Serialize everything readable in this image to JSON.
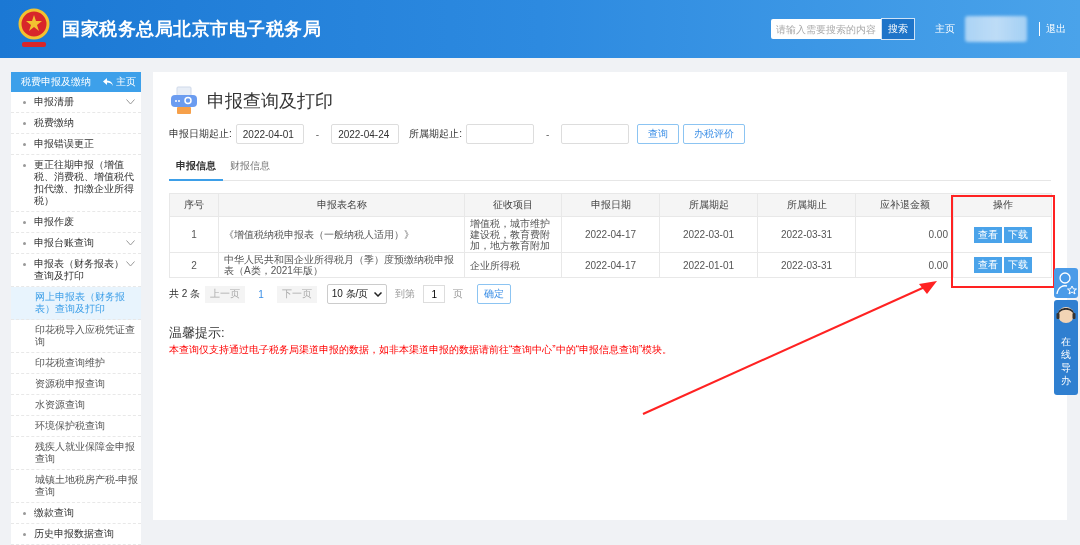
{
  "header": {
    "title": "国家税务总局北京市电子税务局",
    "search": {
      "placeholder": "请输入需要搜索的内容",
      "button": "搜索"
    },
    "home_link": "主页",
    "logout_link": "退出"
  },
  "sidebar": {
    "title": "税费申报及缴纳",
    "home_link": "主页",
    "items": [
      {
        "label": "申报清册",
        "expandable": true,
        "selected": false
      },
      {
        "label": "税费缴纳",
        "expandable": false,
        "selected": false
      },
      {
        "label": "申报错误更正",
        "expandable": false,
        "selected": false
      },
      {
        "label": "更正往期申报（增值税、消费税、增值税代扣代缴、扣缴企业所得税）",
        "expandable": false,
        "selected": false
      },
      {
        "label": "申报作废",
        "expandable": false,
        "selected": false
      },
      {
        "label": "申报台账查询",
        "expandable": true,
        "selected": false
      },
      {
        "label": "申报表（财务报表）查询及打印",
        "expandable": true,
        "selected": false,
        "children": [
          {
            "label": "网上申报表（财务报表）查询及打印",
            "selected": true
          },
          {
            "label": "印花税导入应税凭证查询",
            "selected": false
          },
          {
            "label": "印花税查询维护",
            "selected": false
          },
          {
            "label": "资源税申报查询",
            "selected": false
          },
          {
            "label": "水资源查询",
            "selected": false
          },
          {
            "label": "环境保护税查询",
            "selected": false
          },
          {
            "label": "残疾人就业保障金申报查询",
            "selected": false
          },
          {
            "label": "城镇土地税房产税-申报查询",
            "selected": false
          }
        ]
      },
      {
        "label": "缴款查询",
        "expandable": false,
        "selected": false
      },
      {
        "label": "历史申报数据查询",
        "expandable": false,
        "selected": false
      }
    ]
  },
  "page": {
    "title": "申报查询及打印",
    "filters": {
      "date_label": "申报日期起止:",
      "date_from": "2022-04-01",
      "date_sep": "-",
      "date_to": "2022-04-24",
      "period_label": "所属期起止:",
      "period_sep": "-",
      "query_button": "查询",
      "rating_button": "办税评价"
    },
    "tabs": [
      {
        "label": "申报信息",
        "selected": true
      },
      {
        "label": "财报信息",
        "selected": false
      }
    ],
    "table": {
      "columns": [
        "序号",
        "申报表名称",
        "征收项目",
        "申报日期",
        "所属期起",
        "所属期止",
        "应补退金额",
        "操作"
      ],
      "rows": [
        {
          "no": "1",
          "name": "《增值税纳税申报表（一般纳税人适用）》",
          "item": "增值税，城市维护建设税，教育费附加，地方教育附加",
          "filed": "2022-04-17",
          "from": "2022-03-01",
          "to": "2022-03-31",
          "amount": "0.00",
          "actions": [
            "查看",
            "下载"
          ]
        },
        {
          "no": "2",
          "name": "中华人民共和国企业所得税月（季）度预缴纳税申报表（A类，2021年版）",
          "item": "企业所得税",
          "filed": "2022-04-17",
          "from": "2022-01-01",
          "to": "2022-03-31",
          "amount": "0.00",
          "actions": [
            "查看",
            "下载"
          ]
        }
      ]
    },
    "pagination": {
      "total": "共 2 条",
      "prev": "上一页",
      "prev_disabled": true,
      "current": "1",
      "next": "下一页",
      "next_disabled": true,
      "page_size": "10 条/页",
      "goto_label": "到第",
      "goto_value": "1",
      "page_unit": "页",
      "confirm": "确定"
    },
    "notice": {
      "title": "温馨提示:",
      "text": "本查询仅支持通过电子税务局渠道申报的数据，如非本渠道申报的数据请前往“查询中心”中的“申报信息查询”模块。"
    }
  },
  "help_widget": {
    "label": "在线导办"
  }
}
